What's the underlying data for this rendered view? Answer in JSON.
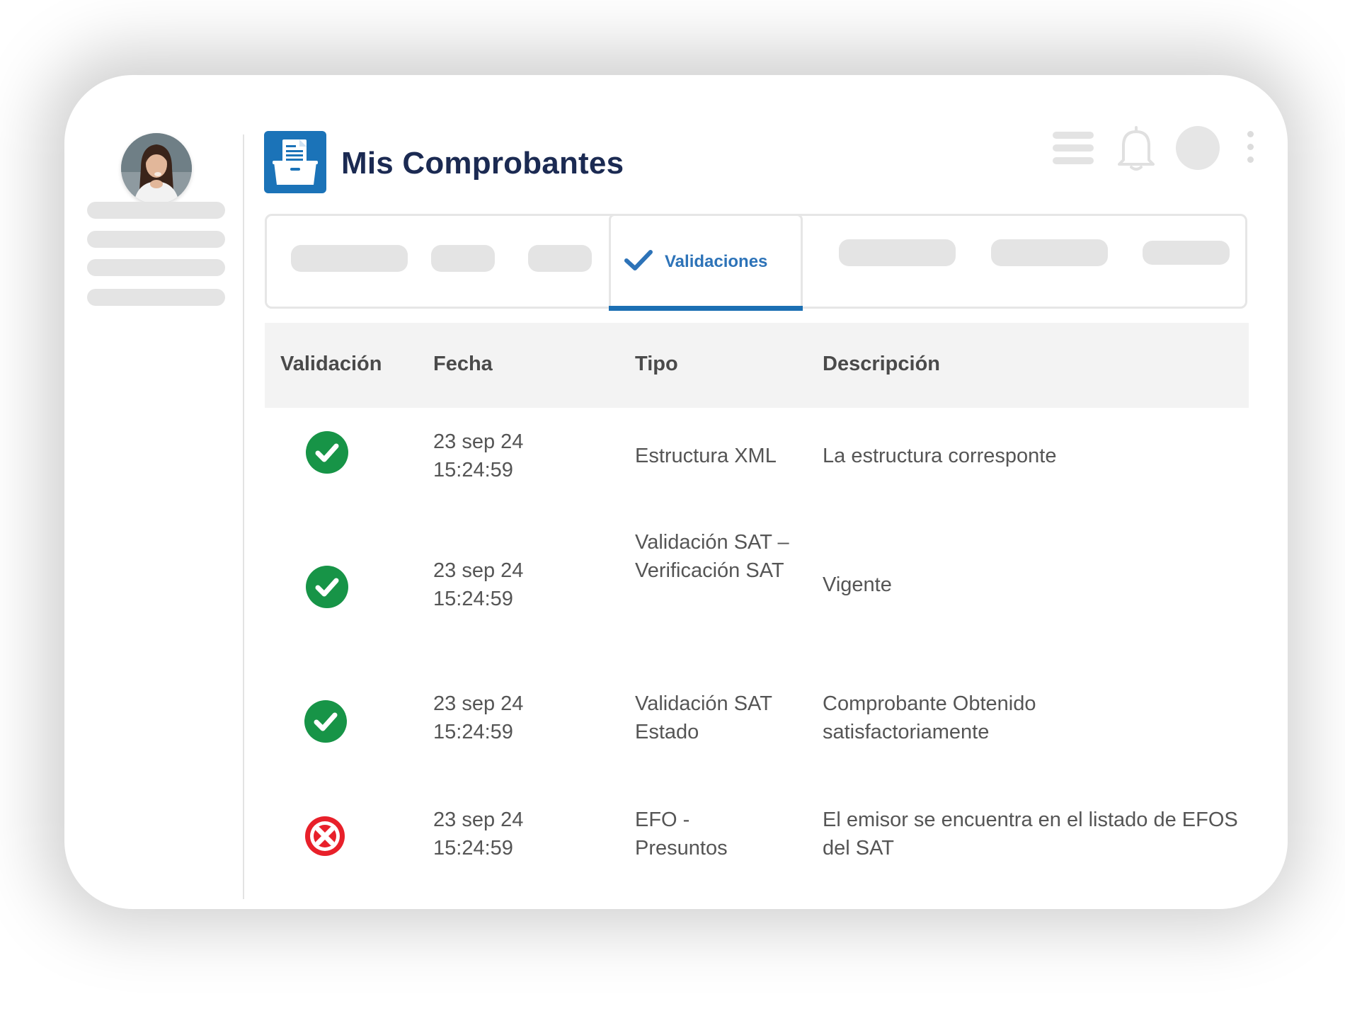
{
  "header": {
    "title": "Mis Comprobantes"
  },
  "tabs": {
    "active_label": "Validaciones"
  },
  "table": {
    "columns": [
      "Validación",
      "Fecha",
      "Tipo",
      "Descripción"
    ],
    "rows": [
      {
        "status": "valid",
        "fecha_line1": "23 sep 24",
        "fecha_line2": "15:24:59",
        "tipo": "Estructura XML",
        "descripcion": "La estructura corresponte"
      },
      {
        "status": "valid",
        "fecha_line1": "23 sep 24",
        "fecha_line2": "15:24:59",
        "tipo": "Validación SAT – Verificación SAT",
        "descripcion": "Vigente"
      },
      {
        "status": "valid",
        "fecha_line1": "23 sep 24",
        "fecha_line2": "15:24:59",
        "tipo": "Validación SAT Estado",
        "descripcion": "Comprobante Obtenido satisfactoriamente"
      },
      {
        "status": "invalid",
        "fecha_line1": "23 sep 24",
        "fecha_line2": "15:24:59",
        "tipo": "EFO - Presuntos",
        "descripcion": "El emisor se encuentra en el listado de EFOS del SAT"
      }
    ]
  },
  "colors": {
    "brand_blue": "#1b73b8",
    "title_navy": "#1b2a52",
    "tab_blue": "#2d73b8",
    "success_green": "#179447",
    "error_red": "#e8202a",
    "placeholder_gray": "#e4e4e4"
  },
  "icons": {
    "app": "folder-document-icon",
    "valid": "check-circle-icon",
    "invalid": "x-circle-icon",
    "tab": "checkmark-icon",
    "menu": "hamburger-menu-icon",
    "notifications": "bell-icon",
    "more": "kebab-menu-icon"
  }
}
